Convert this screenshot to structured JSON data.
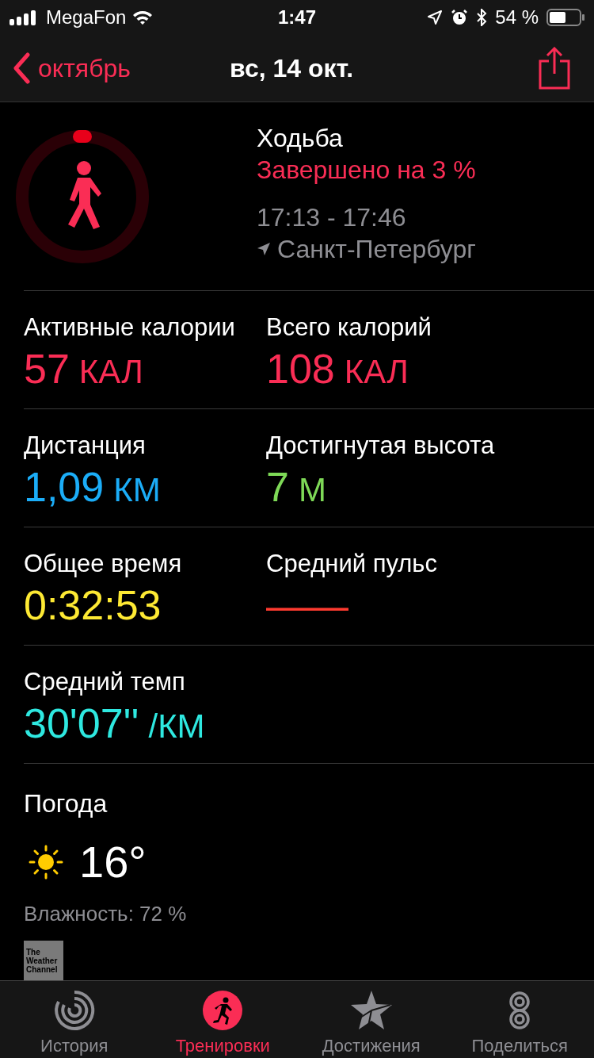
{
  "status_bar": {
    "carrier": "MegaFon",
    "time": "1:47",
    "battery": "54 %"
  },
  "nav": {
    "back": "октябрь",
    "title": "вс, 14 окт."
  },
  "workout": {
    "name": "Ходьба",
    "progress": "Завершено на 3 %",
    "time_range": "17:13 - 17:46",
    "location": "Санкт-Петербург"
  },
  "metrics": [
    [
      {
        "label": "Активные калории",
        "value": "57",
        "unit": "КАЛ",
        "color": "#fa2d55"
      },
      {
        "label": "Всего калорий",
        "value": "108",
        "unit": "КАЛ",
        "color": "#fa2d55"
      }
    ],
    [
      {
        "label": "Дистанция",
        "value": "1,09",
        "unit": "КМ",
        "color": "#1badf8"
      },
      {
        "label": "Достигнутая высота",
        "value": "7",
        "unit": "М",
        "color": "#7ed957"
      }
    ],
    [
      {
        "label": "Общее время",
        "value": "0:32:53",
        "color": "#fde933"
      },
      {
        "label": "Средний пульс",
        "value": "——",
        "color": "#ff3b30"
      }
    ],
    [
      {
        "label": "Средний темп",
        "value": "30'07''",
        "unit": "/КМ",
        "color": "#2ee8e0"
      }
    ]
  ],
  "weather": {
    "label": "Погода",
    "temperature": "16°",
    "humidity": "Влажность: 72 %",
    "logo_text": [
      "The",
      "Weather",
      "Channel"
    ]
  },
  "tabs": [
    {
      "label": "История",
      "selected": false
    },
    {
      "label": "Тренировки",
      "selected": true
    },
    {
      "label": "Достижения",
      "selected": false
    },
    {
      "label": "Поделиться",
      "selected": false
    }
  ]
}
